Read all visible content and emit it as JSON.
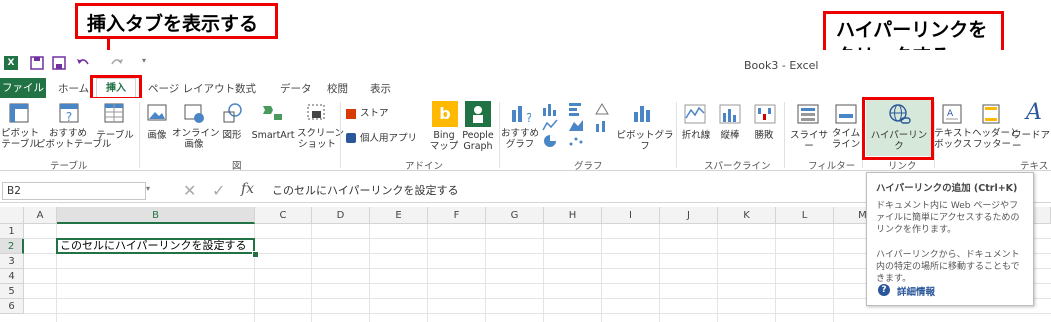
{
  "quick_access": {
    "icons": [
      "excel-logo-icon",
      "save-icon",
      "save-as-icon",
      "undo-icon",
      "redo-icon",
      "customize-icon"
    ]
  },
  "window": {
    "title": "Book3 - Excel"
  },
  "tabs": [
    "ファイル",
    "ホーム",
    "挿入",
    "ページ レイアウト",
    "数式",
    "データ",
    "校閲",
    "表示"
  ],
  "ribbon": {
    "pivot": "ピボット\nテーブル",
    "rec_pivot": "おすすめ\nピボットテーブル",
    "table": "テーブル",
    "group_table": "テーブル",
    "picture": "画像",
    "online_picture": "オンライン\n画像",
    "shapes": "図形",
    "smartart": "SmartArt",
    "screenshot": "スクリーン\nショット",
    "group_illust": "図",
    "store": "ストア",
    "my_apps": "個人用アプリ",
    "bing": "Bing\nマップ",
    "people": "People\nGraph",
    "group_addin": "アドイン",
    "rec_chart": "おすすめ\nグラフ",
    "pivot_chart": "ピボットグラフ",
    "group_chart": "グラフ",
    "sp_line": "折れ線",
    "sp_col": "縦棒",
    "sp_wl": "勝敗",
    "group_spark": "スパークライン",
    "slicer": "スライサー",
    "timeline": "タイム\nライン",
    "group_filter": "フィルター",
    "hyperlink": "ハイパーリンク",
    "group_link": "リンク",
    "textbox": "テキスト\nボックス",
    "header": "ヘッダーと\nフッター",
    "wordart": "ワードアー",
    "group_text": "テキスト"
  },
  "formula_bar": {
    "name_box": "B2",
    "fx": "fx",
    "formula": "このセルにハイパーリンクを設定する"
  },
  "columns": [
    "A",
    "B",
    "C",
    "D",
    "E",
    "F",
    "G",
    "H",
    "I",
    "J",
    "K",
    "L",
    "M",
    "N",
    "O",
    "P"
  ],
  "rows": [
    "1",
    "2",
    "3",
    "4",
    "5",
    "6"
  ],
  "cell_b2": "このセルにハイパーリンクを設定する",
  "callouts": {
    "insert_tab": "挿入タブを表示する",
    "hyperlink_line1": "ハイパーリンクを",
    "hyperlink_line2": "クリックする"
  },
  "tooltip": {
    "title": "ハイパーリンクの追加 (Ctrl+K)",
    "p1": "ドキュメント内に Web ページやファイルに簡単にアクセスするためのリンクを作ります。",
    "p2": "ハイパーリンクから、ドキュメント内の特定の場所に移動することもできます。",
    "more": "詳細情報"
  },
  "colors": {
    "excel_green": "#217346",
    "callout_red": "#ee0000",
    "selected_fill": "#d5e8d9"
  }
}
